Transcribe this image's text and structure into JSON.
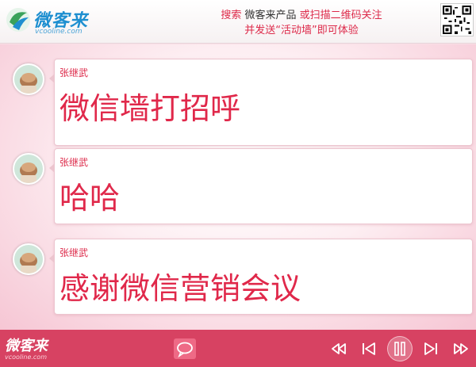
{
  "header": {
    "logo_text": "微客来",
    "logo_sub": "vcooline.com",
    "slogan_line1_a": "搜索",
    "slogan_line1_b": "微客来产品",
    "slogan_line1_c": "或扫描二维码关注",
    "slogan_line2": "并发送“活动墙”即可体验",
    "qr_icon": "qr-code-icon"
  },
  "messages": [
    {
      "name": "张继武",
      "text": "微信墙打招呼"
    },
    {
      "name": "张继武",
      "text": "哈哈"
    },
    {
      "name": "张继武",
      "text": "感谢微信营销会议"
    }
  ],
  "footer": {
    "logo_text": "微客来",
    "logo_sub": "vcooline.com",
    "icons": [
      "chat-bubble-icon",
      "fast-backward-icon",
      "previous-icon",
      "pause-icon",
      "next-icon",
      "fast-forward-icon"
    ]
  },
  "colors": {
    "accent": "#dd2a4a",
    "footer_bg": "#d74262",
    "brand_blue": "#1e8fd0"
  }
}
